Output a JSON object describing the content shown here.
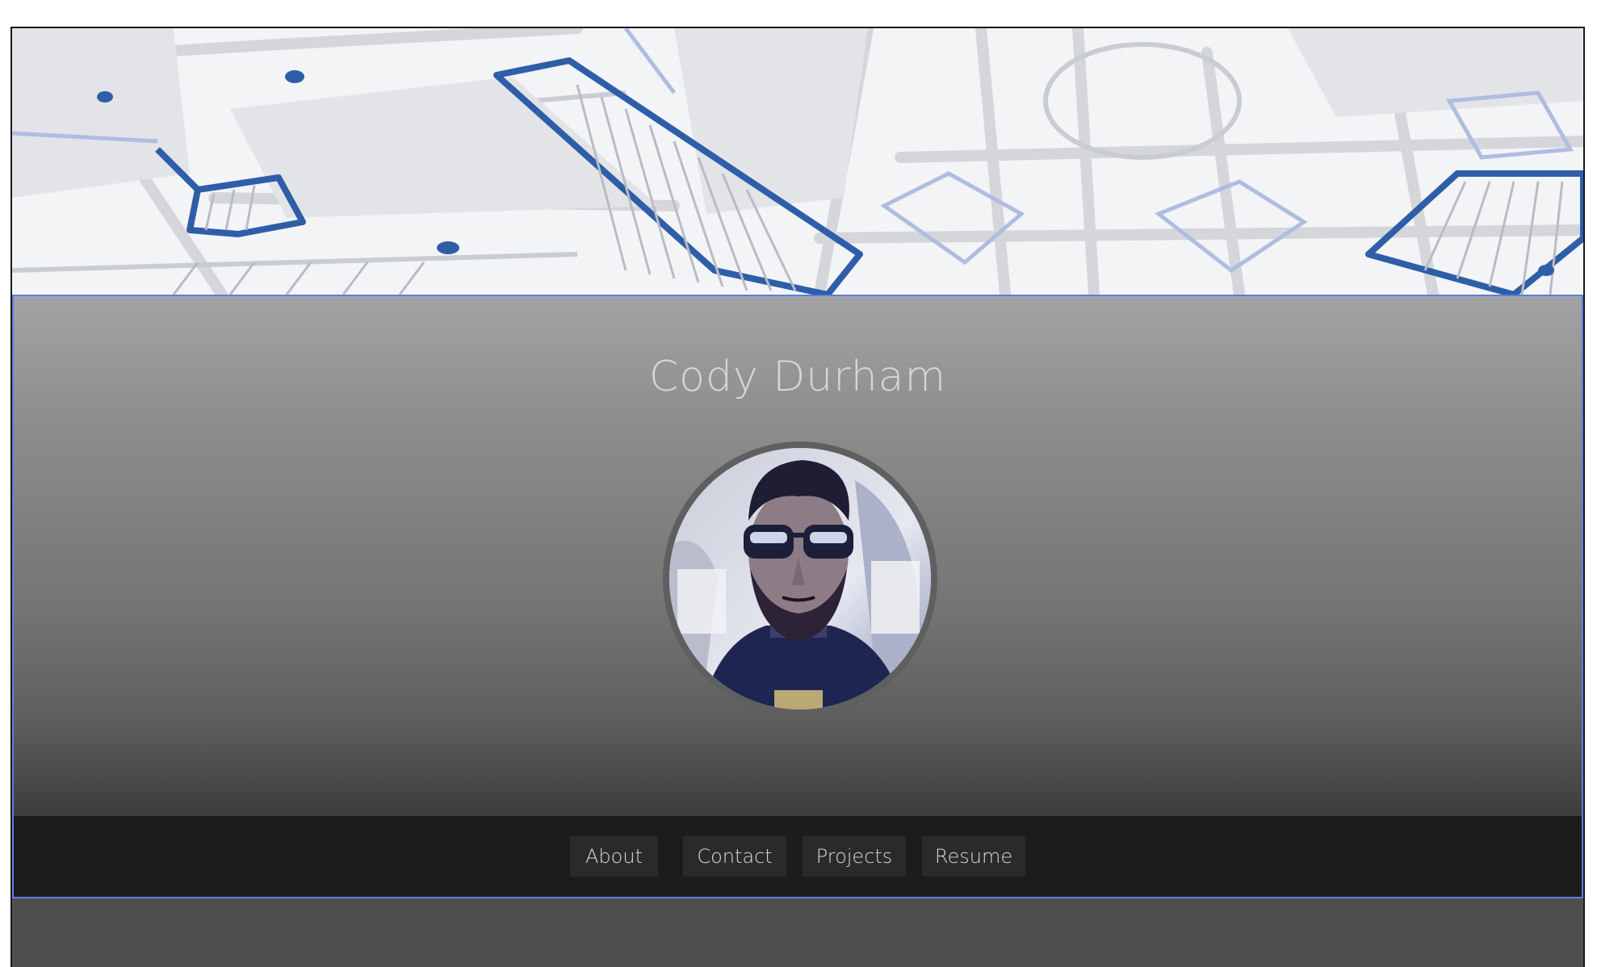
{
  "header": {
    "name": "Cody Durham"
  },
  "avatar": {
    "icon": "profile-photo"
  },
  "nav": {
    "items": [
      {
        "label": "About"
      },
      {
        "label": "Contact"
      },
      {
        "label": "Projects"
      },
      {
        "label": "Resume"
      }
    ]
  },
  "colors": {
    "banner_accent": "#2f5ea8",
    "hero_top": "#a3a3a5",
    "hero_bottom": "#2c2c2c",
    "nav_bg": "#1c1c1c",
    "nav_button_bg": "#2b2a2b",
    "selection_outline": "#5b7ee0"
  }
}
